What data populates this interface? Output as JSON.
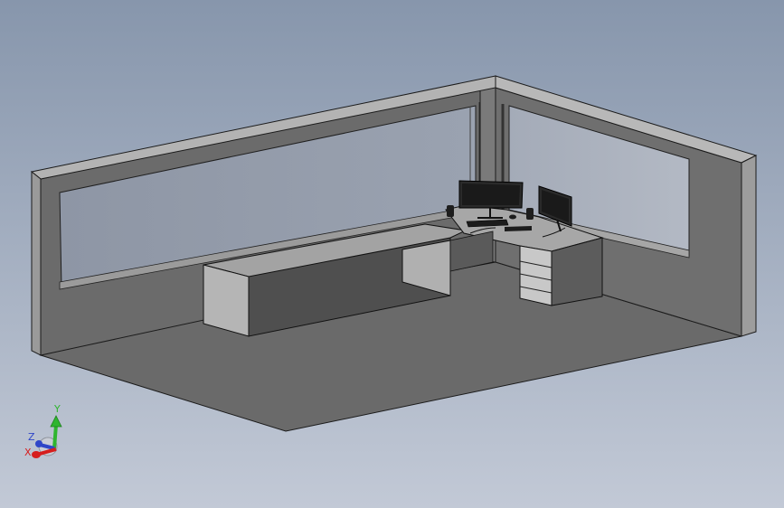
{
  "viewport": {
    "background_top": "#8796ac",
    "background_bottom": "#c2c9d6"
  },
  "triad": {
    "y_label": "Y",
    "z_label": "Z",
    "x_label": "X",
    "y_color": "#2fb52f",
    "z_color": "#2f46c8",
    "x_color": "#d61e1e"
  }
}
